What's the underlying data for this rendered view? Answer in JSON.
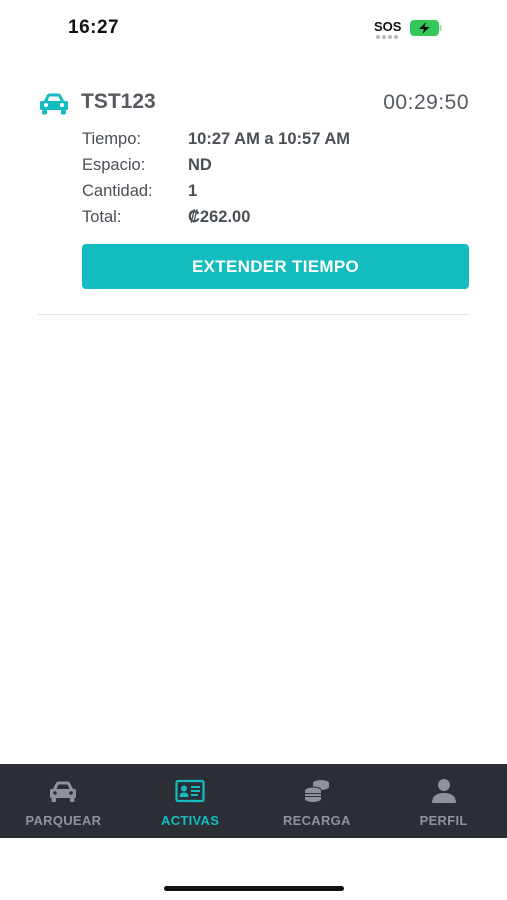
{
  "status_bar": {
    "time": "16:27",
    "sos": "SOS",
    "battery_color": "#34c759"
  },
  "parking": {
    "plate": "TST123",
    "timer": "00:29:50",
    "rows": [
      {
        "label": "Tiempo:",
        "value": "10:27 AM a 10:57 AM"
      },
      {
        "label": "Espacio:",
        "value": "ND"
      },
      {
        "label": "Cantidad:",
        "value": "1"
      },
      {
        "label": "Total:",
        "value": "₡262.00"
      }
    ],
    "extend_label": "EXTENDER TIEMPO"
  },
  "nav": {
    "items": [
      {
        "label": "PARQUEAR",
        "icon": "car-icon",
        "active": false
      },
      {
        "label": "ACTIVAS",
        "icon": "ticket-icon",
        "active": true
      },
      {
        "label": "RECARGA",
        "icon": "coins-icon",
        "active": false
      },
      {
        "label": "PERFIL",
        "icon": "person-icon",
        "active": false
      }
    ]
  },
  "colors": {
    "accent": "#13bdbf",
    "nav_background": "#2b2f35",
    "nav_inactive": "#8e939a",
    "text": "#4a4f55"
  }
}
